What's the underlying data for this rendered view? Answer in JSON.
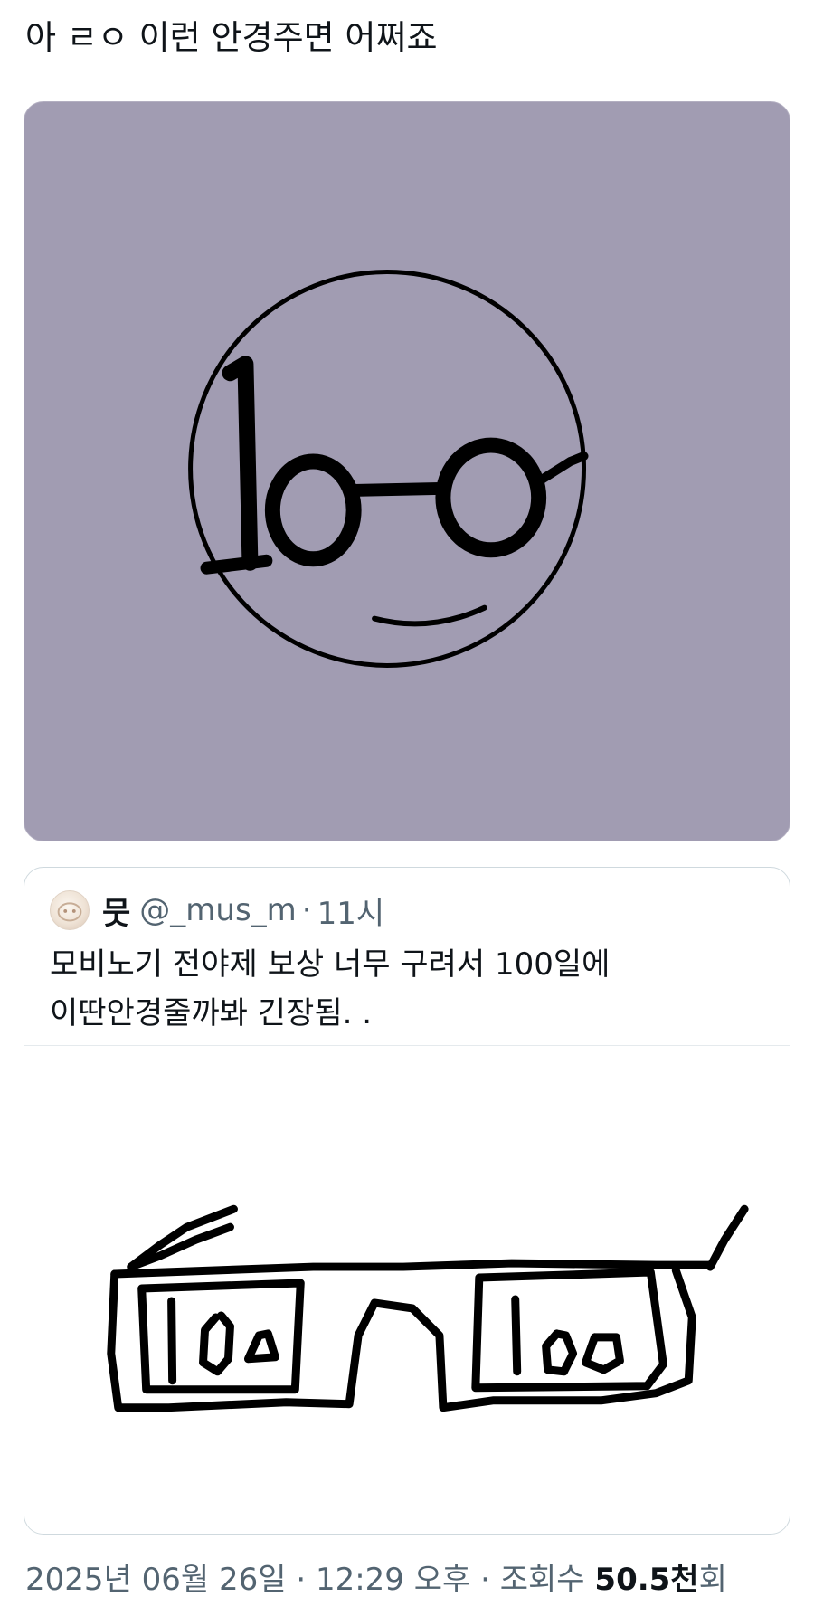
{
  "tweet": {
    "text": "아 ㄹㅇ 이런 안경주면 어쩌죠"
  },
  "quote": {
    "avatar_icon": "avatar-image",
    "name": "뭇",
    "handle": "@_mus_m",
    "separator": "·",
    "time": "11시",
    "text": "모비노기 전야제 보상 너무 구려서 100일에\n이딴안경줄까봐 긴장됨. ."
  },
  "meta": {
    "date": "2025년 06월 26일",
    "sep1": " · ",
    "time": "12:29 오후",
    "sep2": " · ",
    "views_label": "조회수 ",
    "views_count": "50.5천",
    "views_suffix": "회"
  },
  "colors": {
    "main_media_bg": "#a19cb2",
    "secondary_text": "#536471",
    "border": "#cfd9de"
  }
}
